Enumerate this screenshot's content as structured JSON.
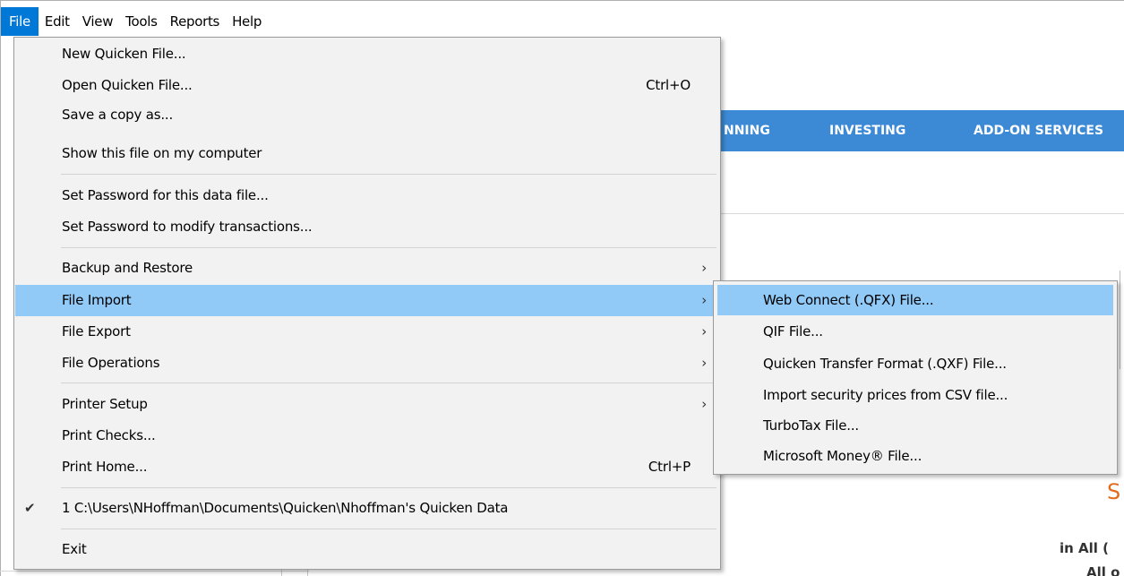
{
  "menubar": {
    "items": [
      "File",
      "Edit",
      "View",
      "Tools",
      "Reports",
      "Help"
    ]
  },
  "background": {
    "nav_tabs": [
      "NNING",
      "INVESTING",
      "ADD-ON SERVICES"
    ],
    "partial_text_1": "in All (",
    "partial_text_2": "All o"
  },
  "file_menu": {
    "items": [
      {
        "label": "New Quicken File...",
        "shortcut": "",
        "submenu": false
      },
      {
        "label": "Open Quicken File...",
        "shortcut": "Ctrl+O",
        "submenu": false
      },
      {
        "label": "Save a copy as...",
        "shortcut": "",
        "submenu": false
      },
      {
        "label": "Show this file on my computer",
        "shortcut": "",
        "submenu": false
      },
      {
        "label": "Set Password for this data file...",
        "shortcut": "",
        "submenu": false
      },
      {
        "label": "Set Password to modify transactions...",
        "shortcut": "",
        "submenu": false
      },
      {
        "label": "Backup and Restore",
        "shortcut": "",
        "submenu": true
      },
      {
        "label": "File Import",
        "shortcut": "",
        "submenu": true,
        "highlighted": true
      },
      {
        "label": "File Export",
        "shortcut": "",
        "submenu": true
      },
      {
        "label": "File Operations",
        "shortcut": "",
        "submenu": true
      },
      {
        "label": "Printer Setup",
        "shortcut": "",
        "submenu": true
      },
      {
        "label": "Print Checks...",
        "shortcut": "",
        "submenu": false
      },
      {
        "label": "Print Home...",
        "shortcut": "Ctrl+P",
        "submenu": false
      },
      {
        "label": "1 C:\\Users\\NHoffman\\Documents\\Quicken\\Nhoffman's Quicken Data",
        "shortcut": "",
        "submenu": false,
        "checked": true
      },
      {
        "label": "Exit",
        "shortcut": "",
        "submenu": false
      }
    ]
  },
  "import_submenu": {
    "items": [
      {
        "label": "Web Connect (.QFX) File...",
        "highlighted": true
      },
      {
        "label": "QIF File..."
      },
      {
        "label": "Quicken Transfer Format (.QXF) File..."
      },
      {
        "label": "Import security prices from CSV file..."
      },
      {
        "label": "TurboTax File..."
      },
      {
        "label": "Microsoft Money® File..."
      }
    ]
  },
  "icons": {
    "submenu_arrow": "chevron-right-icon",
    "check": "checkmark-icon"
  },
  "colors": {
    "menubar_active": "#0078d7",
    "menu_highlight": "#91c9f7",
    "menu_background": "#f2f2f2",
    "nav_background": "#3c8ad5"
  }
}
